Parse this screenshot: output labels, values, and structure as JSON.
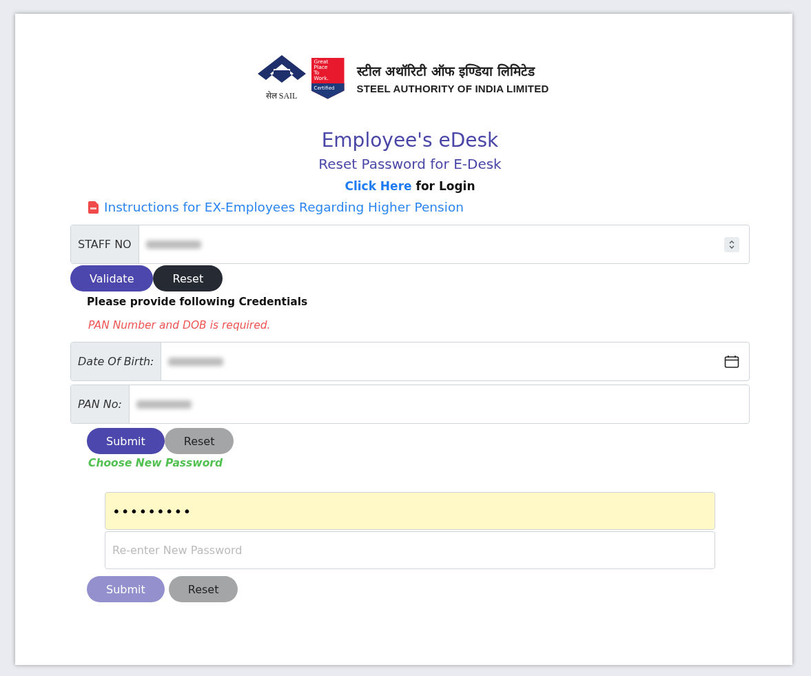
{
  "logo": {
    "sail_text": "सेल SAIL",
    "badge_lines": [
      "Great",
      "Place",
      "To",
      "Work."
    ],
    "badge_certified": "Certified",
    "name_hindi": "स्टील अथॉरिटी ऑफ इण्डिया लिमिटेड",
    "name_english": "STEEL AUTHORITY OF INDIA LIMITED"
  },
  "title": "Employee's eDesk",
  "subtitle": "Reset Password for E-Desk",
  "login_line": {
    "link": "Click Here",
    "text": "for Login"
  },
  "instructions_link": "Instructions for EX-Employees Regarding Higher Pension",
  "staff_field": {
    "label": "STAFF NO",
    "redacted": true
  },
  "staff_buttons": [
    {
      "label": "Validate",
      "kind": "primary",
      "disabled": false
    },
    {
      "label": "Reset",
      "kind": "dark",
      "disabled": false
    }
  ],
  "credentials_heading": "Please provide following Credentials",
  "error_message": "PAN Number and DOB is required.",
  "credential_fields": [
    {
      "label": "Date Of Birth:",
      "kind": "date",
      "redacted": true
    },
    {
      "label": "PAN No:",
      "kind": "text",
      "redacted": true
    }
  ],
  "credential_buttons": [
    {
      "label": "Submit",
      "kind": "primary",
      "disabled": false
    },
    {
      "label": "Reset",
      "kind": "grey",
      "disabled": false
    }
  ],
  "password_heading": "Choose New Password",
  "password_fields": [
    {
      "value": "•••••••••",
      "autofilled": true
    },
    {
      "placeholder": "Re-enter New Password",
      "autofilled": false
    }
  ],
  "password_buttons": [
    {
      "label": "Submit",
      "kind": "primary",
      "disabled": true
    },
    {
      "label": "Reset",
      "kind": "grey",
      "disabled": false
    }
  ]
}
